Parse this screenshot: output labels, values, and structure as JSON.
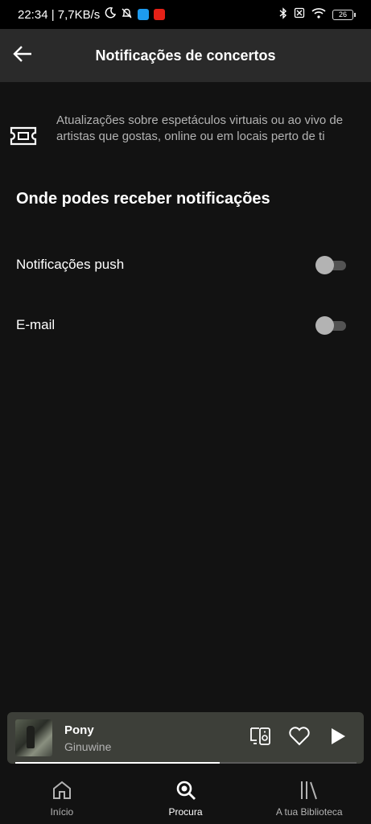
{
  "status_bar": {
    "time_speed": "22:34 | 7,7KB/s",
    "battery": "26",
    "icons": [
      "moon-icon",
      "bell-off-icon",
      "twitter-icon",
      "youtube-icon",
      "bluetooth-icon",
      "sim-off-icon",
      "wifi-icon",
      "battery-icon"
    ]
  },
  "header": {
    "title": "Notificações de concertos",
    "back_icon": "arrow-left-icon"
  },
  "description": {
    "icon": "ticket-icon",
    "text": "Atualizações sobre espetáculos virtuais ou ao vivo de artistas que gostas, online ou em locais perto de ti"
  },
  "section": {
    "title": "Onde podes receber notificações"
  },
  "settings": [
    {
      "label": "Notificações push",
      "enabled": false
    },
    {
      "label": "E-mail",
      "enabled": false
    }
  ],
  "mini_player": {
    "title": "Pony",
    "artist": "Ginuwine",
    "progress": 0.6
  },
  "bottom_nav": [
    {
      "label": "Início",
      "icon": "home-icon",
      "active": false
    },
    {
      "label": "Procura",
      "icon": "search-icon",
      "active": true
    },
    {
      "label": "A tua Biblioteca",
      "icon": "library-icon",
      "active": false
    }
  ],
  "colors": {
    "background": "#121212",
    "header": "#2a2a2a",
    "mini_player": "#3d3f39",
    "secondary_text": "#b3b3b3"
  }
}
